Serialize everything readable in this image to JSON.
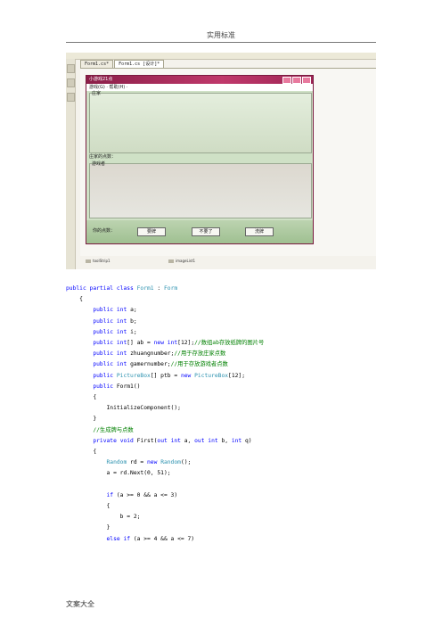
{
  "page_header": "实用标准",
  "page_footer": "文案大全",
  "ide": {
    "tabs": [
      "Form1.cs*",
      "Form1.cs [设计]*"
    ],
    "form": {
      "title": "小游戏21点",
      "menu": "游戏(G) · 帮助(H) ·",
      "group1_label": "庄家",
      "score_label": "庄家的点数：",
      "group2_label": "游戏者",
      "bottom_label": "你的点数：",
      "buttons": [
        "要牌",
        "不要了",
        "洗牌"
      ]
    },
    "components": [
      "toolStrip1",
      "imageList1"
    ]
  },
  "code_lines": [
    [
      0,
      [
        [
          "kw",
          "public "
        ],
        [
          "kw",
          "partial "
        ],
        [
          "kw",
          "class "
        ],
        [
          "ty",
          "Form1"
        ],
        [
          "p",
          " : "
        ],
        [
          "ty",
          "Form"
        ]
      ]
    ],
    [
      1,
      [
        [
          "p",
          "{"
        ]
      ]
    ],
    [
      2,
      [
        [
          "kw",
          "public "
        ],
        [
          "kw",
          "int "
        ],
        [
          "p",
          "a;"
        ]
      ]
    ],
    [
      2,
      [
        [
          "kw",
          "public "
        ],
        [
          "kw",
          "int "
        ],
        [
          "p",
          "b;"
        ]
      ]
    ],
    [
      2,
      [
        [
          "kw",
          "public "
        ],
        [
          "kw",
          "int "
        ],
        [
          "p",
          "i;"
        ]
      ]
    ],
    [
      2,
      [
        [
          "kw",
          "public "
        ],
        [
          "kw",
          "int"
        ],
        [
          "p",
          "[] ab = "
        ],
        [
          "kw",
          "new "
        ],
        [
          "kw",
          "int"
        ],
        [
          "p",
          "[12];"
        ],
        [
          "cm",
          "//数组ab存放纸牌的图片号"
        ]
      ]
    ],
    [
      2,
      [
        [
          "kw",
          "public "
        ],
        [
          "kw",
          "int "
        ],
        [
          "p",
          "zhuangnumber;"
        ],
        [
          "cm",
          "//用于存放庄家点数"
        ]
      ]
    ],
    [
      2,
      [
        [
          "kw",
          "public "
        ],
        [
          "kw",
          "int "
        ],
        [
          "p",
          "gamernumber;"
        ],
        [
          "cm",
          "//用于存放游戏者点数"
        ]
      ]
    ],
    [
      2,
      [
        [
          "kw",
          "public "
        ],
        [
          "ty",
          "PictureBox"
        ],
        [
          "p",
          "[] ptb = "
        ],
        [
          "kw",
          "new "
        ],
        [
          "ty",
          "PictureBox"
        ],
        [
          "p",
          "[12];"
        ]
      ]
    ],
    [
      2,
      [
        [
          "kw",
          "public "
        ],
        [
          "p",
          "Form1()"
        ]
      ]
    ],
    [
      2,
      [
        [
          "p",
          "{"
        ]
      ]
    ],
    [
      3,
      [
        [
          "p",
          "InitializeComponent();"
        ]
      ]
    ],
    [
      2,
      [
        [
          "p",
          "}"
        ]
      ]
    ],
    [
      2,
      [
        [
          "cm",
          "//生成牌与点数"
        ]
      ]
    ],
    [
      2,
      [
        [
          "kw",
          "private "
        ],
        [
          "kw",
          "void "
        ],
        [
          "p",
          "First("
        ],
        [
          "kw",
          "out "
        ],
        [
          "kw",
          "int "
        ],
        [
          "p",
          "a, "
        ],
        [
          "kw",
          "out "
        ],
        [
          "kw",
          "int "
        ],
        [
          "p",
          "b, "
        ],
        [
          "kw",
          "int "
        ],
        [
          "p",
          "q)"
        ]
      ]
    ],
    [
      2,
      [
        [
          "p",
          "{"
        ]
      ]
    ],
    [
      3,
      [
        [
          "ty",
          "Random "
        ],
        [
          "p",
          "rd = "
        ],
        [
          "kw",
          "new "
        ],
        [
          "ty",
          "Random"
        ],
        [
          "p",
          "();"
        ]
      ]
    ],
    [
      3,
      [
        [
          "p",
          "a = rd.Next(0, 51);"
        ]
      ]
    ],
    [
      3,
      [
        [
          "p",
          ""
        ]
      ]
    ],
    [
      3,
      [
        [
          "kw",
          "if "
        ],
        [
          "p",
          "(a >= 0 && a <= 3)"
        ]
      ]
    ],
    [
      3,
      [
        [
          "p",
          "{"
        ]
      ]
    ],
    [
      4,
      [
        [
          "p",
          "b = 2;"
        ]
      ]
    ],
    [
      3,
      [
        [
          "p",
          "}"
        ]
      ]
    ],
    [
      3,
      [
        [
          "kw",
          "else "
        ],
        [
          "kw",
          "if "
        ],
        [
          "p",
          "(a >= 4 && a <= 7)"
        ]
      ]
    ]
  ]
}
